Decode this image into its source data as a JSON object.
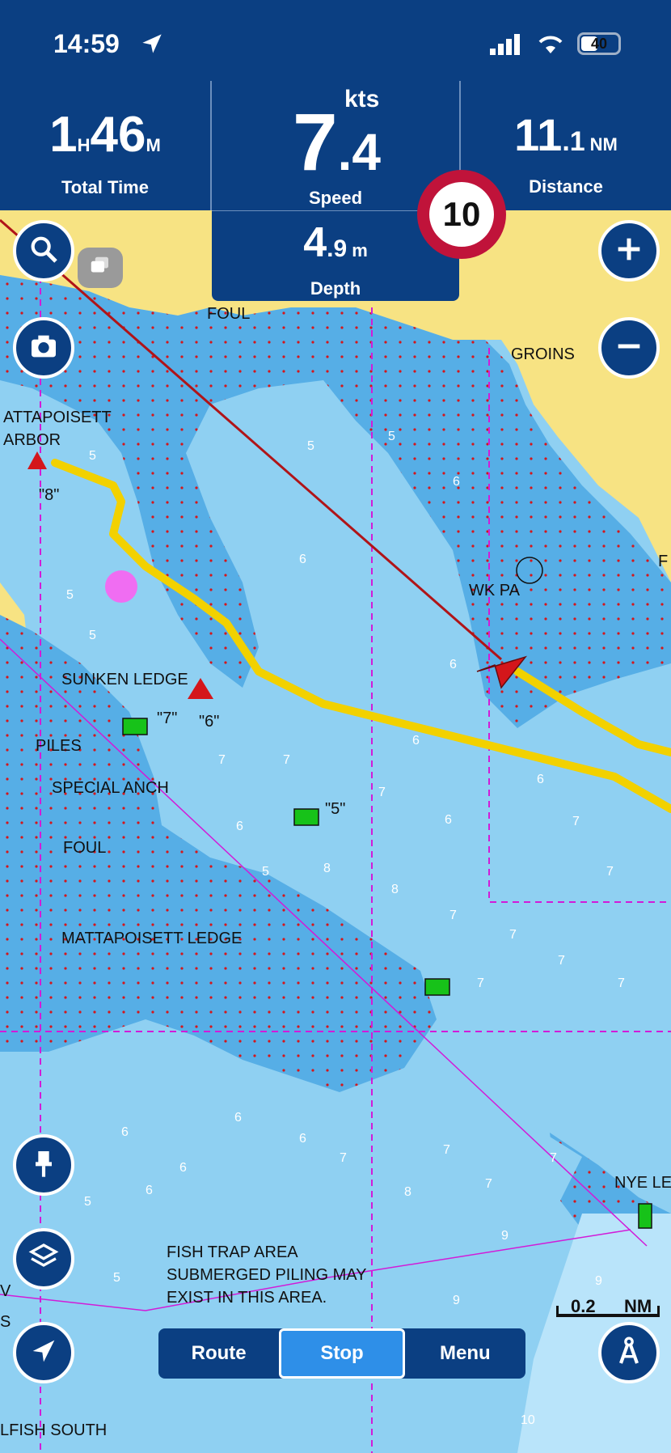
{
  "status": {
    "time": "14:59",
    "battery": "40"
  },
  "header": {
    "total_time_h": "1",
    "total_time_h_unit": "H",
    "total_time_m": "46",
    "total_time_m_unit": "M",
    "total_time_label": "Total Time",
    "speed_unit": "kts",
    "speed_int": "7",
    "speed_dec": ".4",
    "speed_label": "Speed",
    "distance_int": "11",
    "distance_dec": ".1",
    "distance_unit": "NM",
    "distance_label": "Distance",
    "depth_int": "4",
    "depth_dec": ".9",
    "depth_unit": "m",
    "depth_label": "Depth"
  },
  "speed_limit": "10",
  "map_labels": {
    "foul_top": "FOUL",
    "groins": "GROINS",
    "harbor_1": "ATTAPOISETT",
    "harbor_2": "ARBOR",
    "wk": "WK PA",
    "sunken": "SUNKEN LEDGE",
    "b7": "\"7\"",
    "b6": "\"6\"",
    "b8": "\"8\"",
    "piles": "PILES",
    "special": "SPECIAL ANCH",
    "b5": "\"5\"",
    "foul_mid": "FOUL",
    "matt_ledge": "MATTAPOISETT LEDGE",
    "nye": "NYE LE",
    "fish1": "FISH TRAP AREA",
    "fish2": "SUBMERGED PILING MAY",
    "fish3": "EXIST IN THIS AREA.",
    "fish_south": "LFISH SOUTH",
    "v": "V",
    "s": "S",
    "f": "F"
  },
  "scale": {
    "value": "0.2",
    "unit": "NM"
  },
  "bottom_bar": {
    "route": "Route",
    "stop": "Stop",
    "menu": "Menu"
  },
  "icons": [
    "search-icon",
    "camera-icon",
    "zoom-in-icon",
    "zoom-out-icon",
    "pin-icon",
    "layers-icon",
    "navigation-arrow-icon",
    "compass-icon",
    "chat-icon",
    "location-arrow-icon"
  ]
}
